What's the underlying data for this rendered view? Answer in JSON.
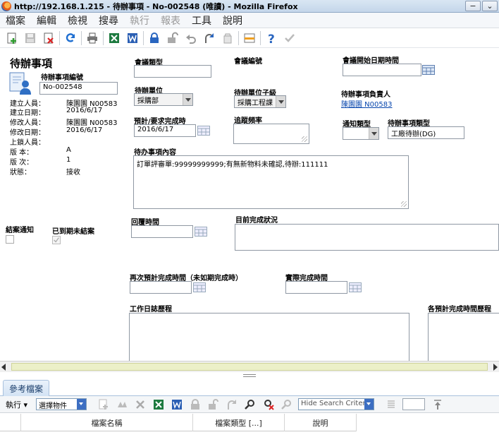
{
  "window": {
    "title": "http://192.168.1.215 - 待辦事項 - No-002548 (唯讀) - Mozilla Firefox"
  },
  "menu": [
    {
      "label": "檔案",
      "enabled": true
    },
    {
      "label": "編輯",
      "enabled": true
    },
    {
      "label": "檢視",
      "enabled": true
    },
    {
      "label": "搜尋",
      "enabled": true
    },
    {
      "label": "執行",
      "enabled": false
    },
    {
      "label": "報表",
      "enabled": false
    },
    {
      "label": "工具",
      "enabled": true
    },
    {
      "label": "說明",
      "enabled": true
    }
  ],
  "toolbar_icons": [
    "new-icon",
    "save-icon",
    "delete-icon",
    "refresh-icon",
    "print-icon",
    "excel-icon",
    "word-icon",
    "lock-icon",
    "unlock-icon",
    "undo-icon",
    "redo-icon",
    "clear-icon",
    "layout-icon",
    "help-icon",
    "check-icon"
  ],
  "record": {
    "heading": "待辦事項",
    "number_label": "待辦事項編號",
    "number_value": "No-002548",
    "info": [
      {
        "label": "建立人員：",
        "value": "陳園園 N00583"
      },
      {
        "label": "建立日期：",
        "value": "2016/6/17"
      },
      {
        "label": "修改人員：",
        "value": "陳園園 N00583"
      },
      {
        "label": "修改日期：",
        "value": "2016/6/17"
      },
      {
        "label": "上鎖人員：",
        "value": ""
      },
      {
        "label": "版 本：",
        "value": "A"
      },
      {
        "label": "版 次：",
        "value": "1"
      },
      {
        "label": "狀態：",
        "value": "接收"
      }
    ]
  },
  "fields": {
    "meeting_type_label": "會議類型",
    "meeting_type_value": "",
    "meeting_no_label": "會議編號",
    "meeting_start_label": "會議開始日期時間",
    "meeting_start_value": "",
    "todo_unit_label": "待辦單位",
    "todo_unit_value": "採購部",
    "todo_subunit_label": "待辦單位子級",
    "todo_subunit_value": "採購工程課",
    "owner_label": "待辦事項負責人",
    "owner_value": "陳園園 N00583",
    "due_label": "預計/要求完成時",
    "due_value": "2016/6/17",
    "track_freq_label": "追蹤頻率",
    "track_freq_value": "",
    "notify_type_label": "通知類型",
    "notify_type_value": "",
    "todo_type_label": "待辦事項類型",
    "todo_type_value": "工廠待辦(DG)",
    "content_label": "待办事項內容",
    "content_value": "訂單評審單:99999999999;有無新物料未確認,待辦:111111",
    "reply_time_label": "回覆時間",
    "current_status_label": "目前完成狀況",
    "close_notice_label": "結案通知",
    "overdue_label": "已到期未結案",
    "re_due_label": "再次預計完成時間（未如期完成時）",
    "actual_done_label": "實際完成時間",
    "work_log_label": "工作日誌歷程",
    "due_history_label": "各預計完成時間歷程"
  },
  "bottom": {
    "tab_label": "參考檔案",
    "exec_label": "執行",
    "select_label": "選擇物件",
    "search_criteria": "Hide Search Criteria",
    "columns": [
      "",
      "檔案名稱",
      "檔案類型 [...]",
      "說明"
    ]
  }
}
